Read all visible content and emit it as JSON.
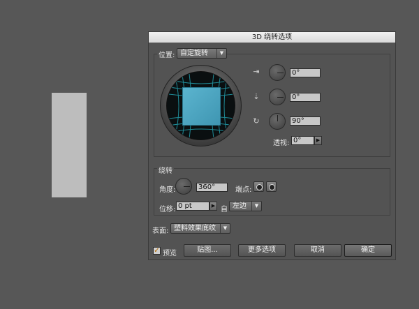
{
  "dialog": {
    "title": "3D 绕转选项",
    "position": {
      "label": "位置:",
      "preset": "自定旋转",
      "rotate_x": "0°",
      "rotate_y": "0°",
      "rotate_z": "90°",
      "perspective_label": "透视:",
      "perspective": "0°"
    },
    "revolve": {
      "group_label": "绕转",
      "angle_label": "角度:",
      "angle": "360°",
      "cap_label": "端点:",
      "offset_label": "位移:",
      "offset": "0 pt",
      "from_label": "自",
      "from_value": "左边"
    },
    "surface": {
      "label": "表面:",
      "value": "塑料效果底纹"
    },
    "footer": {
      "preview_label": "预览",
      "preview_checked": "✓",
      "map_button": "贴图...",
      "more_button": "更多选项",
      "cancel_button": "取消",
      "ok_button": "确定"
    }
  },
  "icons": {
    "x_axis": "rotate-x-axis-icon",
    "y_axis": "rotate-y-axis-icon",
    "z_axis": "rotate-z-axis-icon",
    "dropdown": "chevron-down-icon",
    "stepper": "chevron-right-icon",
    "cap_on": "cap-on-icon",
    "cap_off": "cap-off-icon"
  },
  "colors": {
    "panel": "#535353",
    "background": "#575757",
    "cube_face": "#4aa6c2",
    "grid_lines": "#1f8a96"
  }
}
